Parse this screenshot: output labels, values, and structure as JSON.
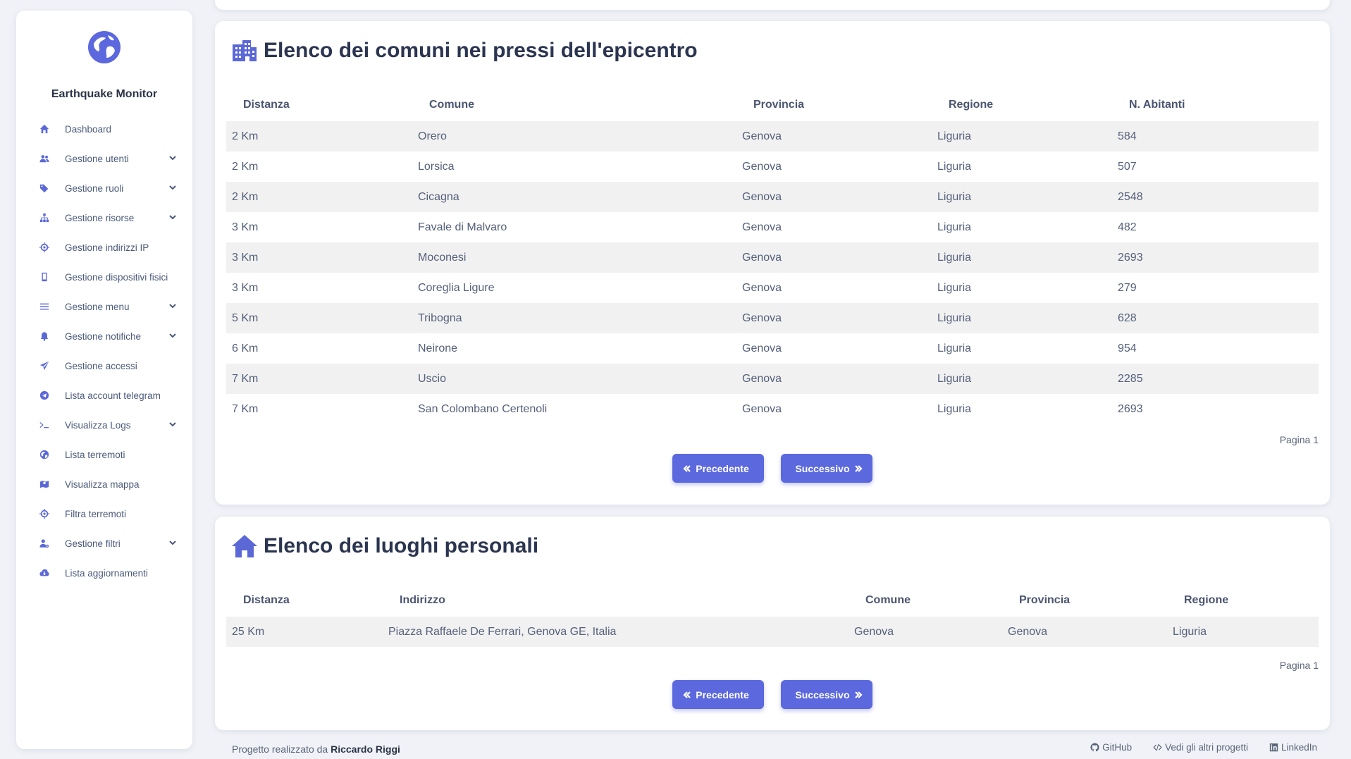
{
  "app": {
    "name": "Earthquake Monitor"
  },
  "sidebar": {
    "items": [
      {
        "label": "Dashboard",
        "icon": "home-icon",
        "expandable": false
      },
      {
        "label": "Gestione utenti",
        "icon": "users-icon",
        "expandable": true
      },
      {
        "label": "Gestione ruoli",
        "icon": "tags-icon",
        "expandable": true
      },
      {
        "label": "Gestione risorse",
        "icon": "sitemap-icon",
        "expandable": true
      },
      {
        "label": "Gestione indirizzi IP",
        "icon": "crosshair-icon",
        "expandable": false
      },
      {
        "label": "Gestione dispositivi fisici",
        "icon": "mobile-icon",
        "expandable": false
      },
      {
        "label": "Gestione menu",
        "icon": "bars-icon",
        "expandable": true
      },
      {
        "label": "Gestione notifiche",
        "icon": "bell-icon",
        "expandable": true
      },
      {
        "label": "Gestione accessi",
        "icon": "paper-plane-icon",
        "expandable": false
      },
      {
        "label": "Lista account telegram",
        "icon": "telegram-icon",
        "expandable": false
      },
      {
        "label": "Visualizza Logs",
        "icon": "terminal-icon",
        "expandable": true
      },
      {
        "label": "Lista terremoti",
        "icon": "globe-icon",
        "expandable": false
      },
      {
        "label": "Visualizza mappa",
        "icon": "map-icon",
        "expandable": false
      },
      {
        "label": "Filtra terremoti",
        "icon": "crosshair-icon",
        "expandable": false
      },
      {
        "label": "Gestione filtri",
        "icon": "user-gear-icon",
        "expandable": true
      },
      {
        "label": "Lista aggiornamenti",
        "icon": "cloud-download-icon",
        "expandable": false
      }
    ]
  },
  "comuni": {
    "title": "Elenco dei comuni nei pressi dell'epicentro",
    "headers": [
      "Distanza",
      "Comune",
      "Provincia",
      "Regione",
      "N. Abitanti"
    ],
    "rows": [
      [
        "2 Km",
        "Orero",
        "Genova",
        "Liguria",
        "584"
      ],
      [
        "2 Km",
        "Lorsica",
        "Genova",
        "Liguria",
        "507"
      ],
      [
        "2 Km",
        "Cicagna",
        "Genova",
        "Liguria",
        "2548"
      ],
      [
        "3 Km",
        "Favale di Malvaro",
        "Genova",
        "Liguria",
        "482"
      ],
      [
        "3 Km",
        "Moconesi",
        "Genova",
        "Liguria",
        "2693"
      ],
      [
        "3 Km",
        "Coreglia Ligure",
        "Genova",
        "Liguria",
        "279"
      ],
      [
        "5 Km",
        "Tribogna",
        "Genova",
        "Liguria",
        "628"
      ],
      [
        "6 Km",
        "Neirone",
        "Genova",
        "Liguria",
        "954"
      ],
      [
        "7 Km",
        "Uscio",
        "Genova",
        "Liguria",
        "2285"
      ],
      [
        "7 Km",
        "San Colombano Certenoli",
        "Genova",
        "Liguria",
        "2693"
      ]
    ],
    "page_label": "Pagina 1",
    "prev_label": "Precedente",
    "next_label": "Successivo"
  },
  "luoghi": {
    "title": "Elenco dei luoghi personali",
    "headers": [
      "Distanza",
      "Indirizzo",
      "Comune",
      "Provincia",
      "Regione"
    ],
    "rows": [
      [
        "25 Km",
        "Piazza Raffaele De Ferrari, Genova GE, Italia",
        "Genova",
        "Genova",
        "Liguria"
      ]
    ],
    "page_label": "Pagina 1",
    "prev_label": "Precedente",
    "next_label": "Successivo"
  },
  "footer": {
    "prefix": "Progetto realizzato da",
    "author": "Riccardo Riggi",
    "links": [
      "GitHub",
      "Vedi gli altri progetti",
      "LinkedIn"
    ]
  },
  "colors": {
    "accent": "#5b68de",
    "background": "#f0f2f7",
    "card": "#ffffff"
  }
}
